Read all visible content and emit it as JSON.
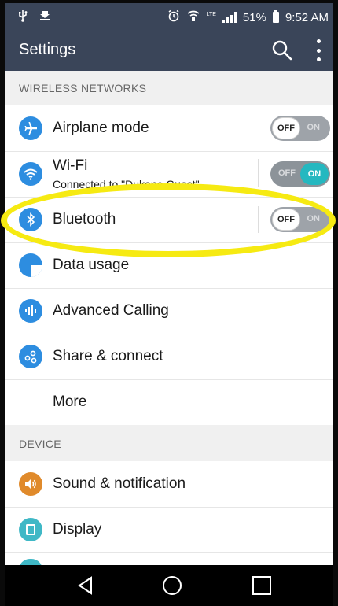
{
  "status_bar": {
    "battery": "51%",
    "time": "9:52 AM",
    "network": "LTE",
    "icons": [
      "usb-icon",
      "download-icon",
      "alarm-icon",
      "wifi-call-icon",
      "signal-icon",
      "battery-icon"
    ]
  },
  "app_bar": {
    "title": "Settings",
    "icons": [
      "search-icon",
      "overflow-menu-icon"
    ]
  },
  "sections": {
    "wireless": "WIRELESS NETWORKS",
    "device": "DEVICE"
  },
  "rows": {
    "airplane": {
      "label": "Airplane mode",
      "toggle": "OFF",
      "toggle_ghost": "ON",
      "icon": "airplane-icon"
    },
    "wifi": {
      "label": "Wi-Fi",
      "sub": "Connected to \"Dukane Guest\"",
      "toggle": "ON",
      "toggle_ghost": "OFF",
      "icon": "wifi-icon"
    },
    "bluetooth": {
      "label": "Bluetooth",
      "toggle": "OFF",
      "toggle_ghost": "ON",
      "icon": "bluetooth-icon"
    },
    "data_usage": {
      "label": "Data usage",
      "icon": "data-usage-icon"
    },
    "advanced_calling": {
      "label": "Advanced Calling",
      "icon": "advanced-calling-icon"
    },
    "share_connect": {
      "label": "Share & connect",
      "icon": "share-icon"
    },
    "more": {
      "label": "More"
    },
    "sound": {
      "label": "Sound & notification",
      "icon": "sound-icon"
    },
    "display": {
      "label": "Display",
      "icon": "display-icon"
    }
  },
  "nav_bar": [
    "back-icon",
    "home-icon",
    "recents-icon"
  ],
  "colors": {
    "app_bar": "#3a4559",
    "accent_blue": "#2d8de0",
    "toggle_on": "#25b8c0",
    "highlight": "#f6ea12",
    "sound_orange": "#e08a2b",
    "display_teal": "#3fb8c6"
  }
}
